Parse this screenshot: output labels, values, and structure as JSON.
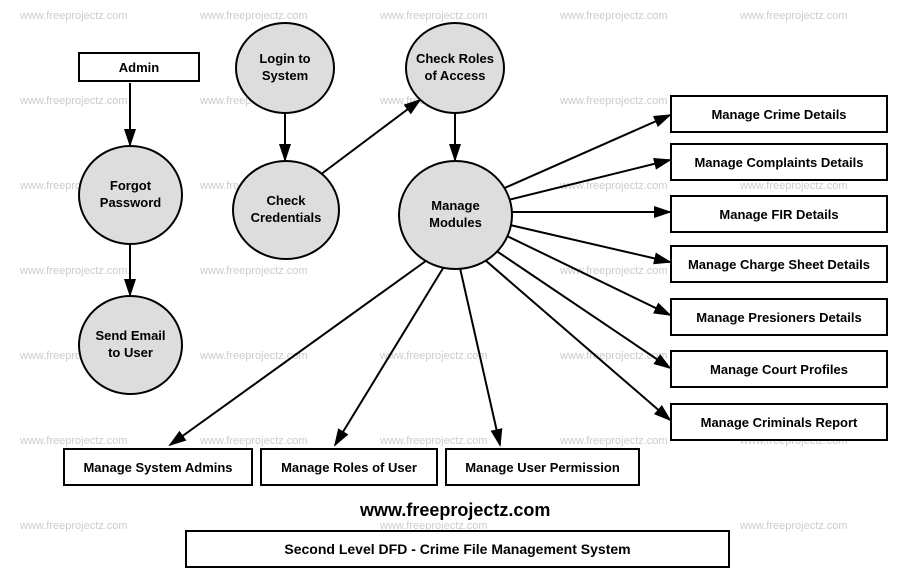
{
  "watermark": "www.freeprojectz.com",
  "site": "www.freeprojectz.com",
  "admin": "Admin",
  "login": "Login to System",
  "check_roles": "Check Roles of Access",
  "forgot": "Forgot Password",
  "check_creds": "Check Credentials",
  "manage_modules": "Manage Modules",
  "send_email": "Send Email to User",
  "manage_crime": "Manage Crime Details",
  "manage_complaints": "Manage Complaints Details",
  "manage_fir": "Manage FIR Details",
  "manage_charge": "Manage Charge Sheet Details",
  "manage_prisoners": "Manage Presioners Details",
  "manage_court": "Manage Court Profiles",
  "manage_criminals": "Manage Criminals Report",
  "manage_system_admins": "Manage System Admins",
  "manage_roles": "Manage Roles of User",
  "manage_permission": "Manage User Permission",
  "title": "Second Level DFD - Crime File Management System"
}
